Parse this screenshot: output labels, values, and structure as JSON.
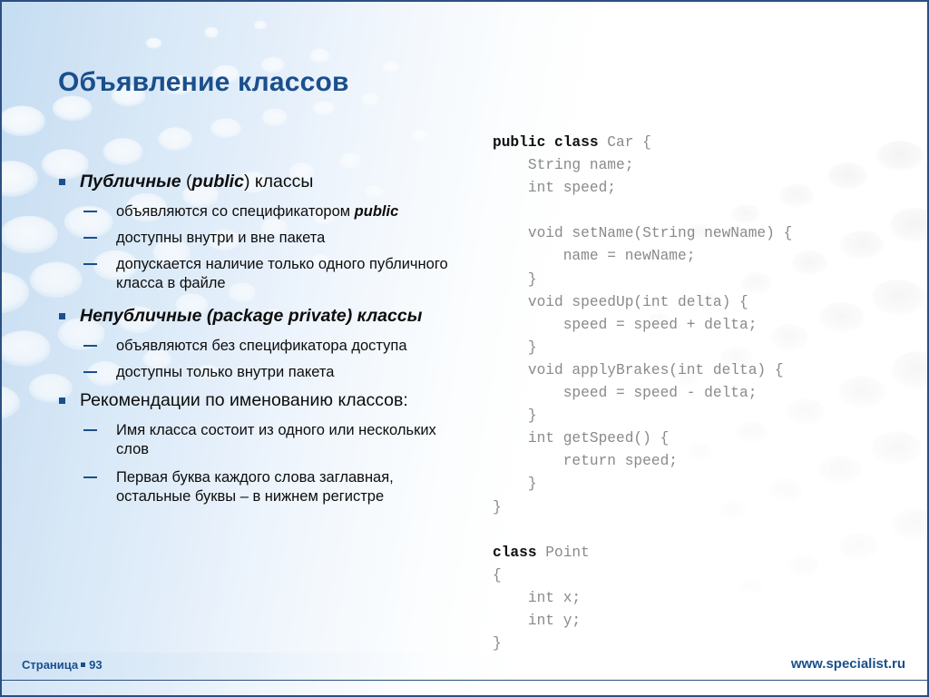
{
  "slide": {
    "title": "Объявление классов",
    "accent_color": "#1a4f8c",
    "background_color": "#c5ddf2",
    "code_text_color": "#8a8a8a",
    "code_keyword_color": "#101010"
  },
  "bullets": [
    {
      "level": 1,
      "marker": "square-bullet",
      "parts": [
        {
          "text": "Публичные ",
          "style": "bold-italic"
        },
        {
          "text": "(",
          "style": "regular"
        },
        {
          "text": "public",
          "style": "bold-italic"
        },
        {
          "text": ") классы",
          "style": "regular"
        }
      ]
    },
    {
      "level": 2,
      "marker": "dash-bullet",
      "parts": [
        {
          "text": "объявляются со спецификатором ",
          "style": "regular"
        },
        {
          "text": "public",
          "style": "bold-italic"
        }
      ]
    },
    {
      "level": 2,
      "marker": "dash-bullet",
      "parts": [
        {
          "text": "доступны  внутри и вне пакета",
          "style": "regular"
        }
      ]
    },
    {
      "level": 2,
      "marker": "dash-bullet",
      "parts": [
        {
          "text": "допускается наличие только одного публичного класса в файле",
          "style": "regular"
        }
      ]
    },
    {
      "level": 1,
      "marker": "square-bullet",
      "parts": [
        {
          "text": "Непубличные (package private) классы",
          "style": "bold-italic"
        }
      ]
    },
    {
      "level": 2,
      "marker": "dash-bullet",
      "parts": [
        {
          "text": "объявляются без спецификатора доступа",
          "style": "regular"
        }
      ]
    },
    {
      "level": 2,
      "marker": "dash-bullet",
      "parts": [
        {
          "text": "доступны только внутри пакета",
          "style": "regular"
        }
      ]
    },
    {
      "level": 1,
      "marker": "square-bullet",
      "parts": [
        {
          "text": "Рекомендации по именованию классов:",
          "style": "regular"
        }
      ]
    },
    {
      "level": 2,
      "marker": "dash-bullet",
      "parts": [
        {
          "text": "Имя класса состоит из одного или нескольких слов",
          "style": "regular"
        }
      ]
    },
    {
      "level": 2,
      "marker": "dash-bullet",
      "parts": [
        {
          "text": "Первая буква каждого слова заглавная, остальные буквы – в нижнем регистре",
          "style": "regular"
        }
      ]
    }
  ],
  "bullet_text": {
    "b0_p0": "Публичные ",
    "b0_p1": "(",
    "b0_p2": "public",
    "b0_p3": ") классы",
    "b1_p0": "объявляются со спецификатором ",
    "b1_p1": "public",
    "b2": "доступны  внутри и вне пакета",
    "b3": "допускается наличие только одного публичного класса в файле",
    "b4": "Непубличные (package private) классы",
    "b5": "объявляются без спецификатора доступа",
    "b6": "доступны только внутри пакета",
    "b7": "Рекомендации по именованию классов:",
    "b8": "Имя класса состоит из одного или нескольких слов",
    "b9": "Первая буква каждого слова заглавная, остальные буквы – в нижнем регистре"
  },
  "code": {
    "language": "java",
    "lines": [
      {
        "keyword": "public class",
        "rest": " Car {"
      },
      {
        "keyword": "",
        "rest": "    String name;"
      },
      {
        "keyword": "",
        "rest": "    int speed;"
      },
      {
        "keyword": "",
        "rest": ""
      },
      {
        "keyword": "",
        "rest": "    void setName(String newName) {"
      },
      {
        "keyword": "",
        "rest": "        name = newName;"
      },
      {
        "keyword": "",
        "rest": "    }"
      },
      {
        "keyword": "",
        "rest": "    void speedUp(int delta) {"
      },
      {
        "keyword": "",
        "rest": "        speed = speed + delta;"
      },
      {
        "keyword": "",
        "rest": "    }"
      },
      {
        "keyword": "",
        "rest": "    void applyBrakes(int delta) {"
      },
      {
        "keyword": "",
        "rest": "        speed = speed - delta;"
      },
      {
        "keyword": "",
        "rest": "    }"
      },
      {
        "keyword": "",
        "rest": "    int getSpeed() {"
      },
      {
        "keyword": "",
        "rest": "        return speed;"
      },
      {
        "keyword": "",
        "rest": "    }"
      },
      {
        "keyword": "",
        "rest": "}"
      },
      {
        "keyword": "",
        "rest": ""
      },
      {
        "keyword": "class",
        "rest": " Point"
      },
      {
        "keyword": "",
        "rest": "{"
      },
      {
        "keyword": "",
        "rest": "    int x;"
      },
      {
        "keyword": "",
        "rest": "    int y;"
      },
      {
        "keyword": "",
        "rest": "}"
      }
    ]
  },
  "footer": {
    "page_label": "Страница",
    "page_number": "93",
    "site": "www.specialist.ru"
  }
}
